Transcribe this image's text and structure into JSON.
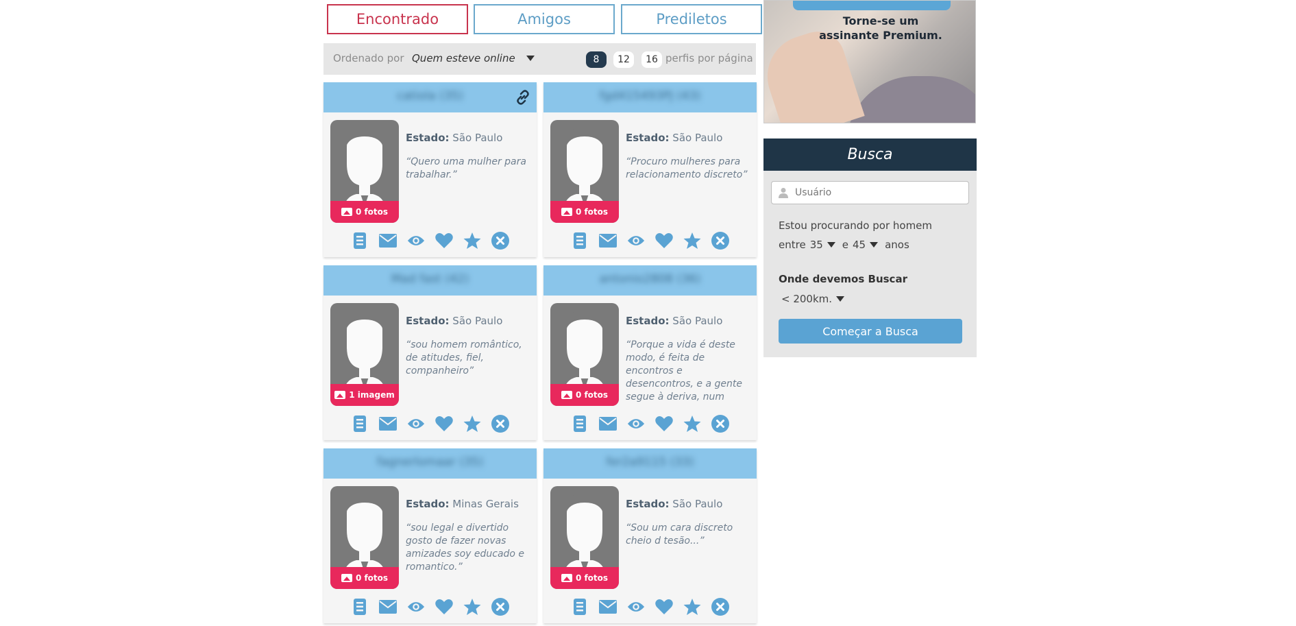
{
  "tabs": [
    {
      "label": "Encontrado"
    },
    {
      "label": "Amigos"
    },
    {
      "label": "Prediletos"
    }
  ],
  "sort": {
    "label": "Ordenado por",
    "selected": "Quem esteve online",
    "per_page_options": [
      "8",
      "12",
      "16"
    ],
    "per_page_selected": "8",
    "per_page_label": "perfis por página"
  },
  "estado_label": "Estado:",
  "profiles": [
    {
      "username": "catiola (35)",
      "estado": "São Paulo",
      "quote": "“Quero uma mulher para trabalhar.”",
      "photos": "0 fotos"
    },
    {
      "username": "fgd415493PJ (43)",
      "estado": "São Paulo",
      "quote": "“Procuro mulheres para relacionamento discreto”",
      "photos": "0 fotos"
    },
    {
      "username": "Mad fast (42)",
      "estado": "São Paulo",
      "quote": "“sou homem romântico, de atitudes, fiel, companheiro”",
      "photos": "1 imagem"
    },
    {
      "username": "antonio2808 (36)",
      "estado": "São Paulo",
      "quote": "“Porque a vida é deste modo, é feita de encontros e desencontros, e a gente segue à deriva, num barco à vela, içada pelo vento, ora",
      "photos": "0 fotos"
    },
    {
      "username": "fagnerlomaar (35)",
      "estado": "Minas Gerais",
      "quote": "“sou legal e divertido gosto de fazer novas amizades soy educado e romantico.”",
      "photos": "0 fotos"
    },
    {
      "username": "fer2a9115 (33)",
      "estado": "São Paulo",
      "quote": "“Sou um cara discreto cheio d tesão...”",
      "photos": "0 fotos"
    }
  ],
  "promo": {
    "line1": "Torne-se um",
    "line2": "assinante Premium."
  },
  "search": {
    "title": "Busca",
    "username_placeholder": "Usuário",
    "looking_for": "Estou procurando por homem",
    "age_from_prefix": "entre",
    "age_from": "35",
    "age_to_prefix": "e",
    "age_to": "45",
    "age_suffix": "anos",
    "where_label": "Onde devemos Buscar",
    "distance": "< 200km.",
    "submit_label": "Começar a Busca"
  },
  "colors": {
    "accent_blue": "#5aa3d3",
    "active_red": "#c8334d",
    "badge_pink": "#e8285c",
    "dark_navy": "#1f3547"
  }
}
